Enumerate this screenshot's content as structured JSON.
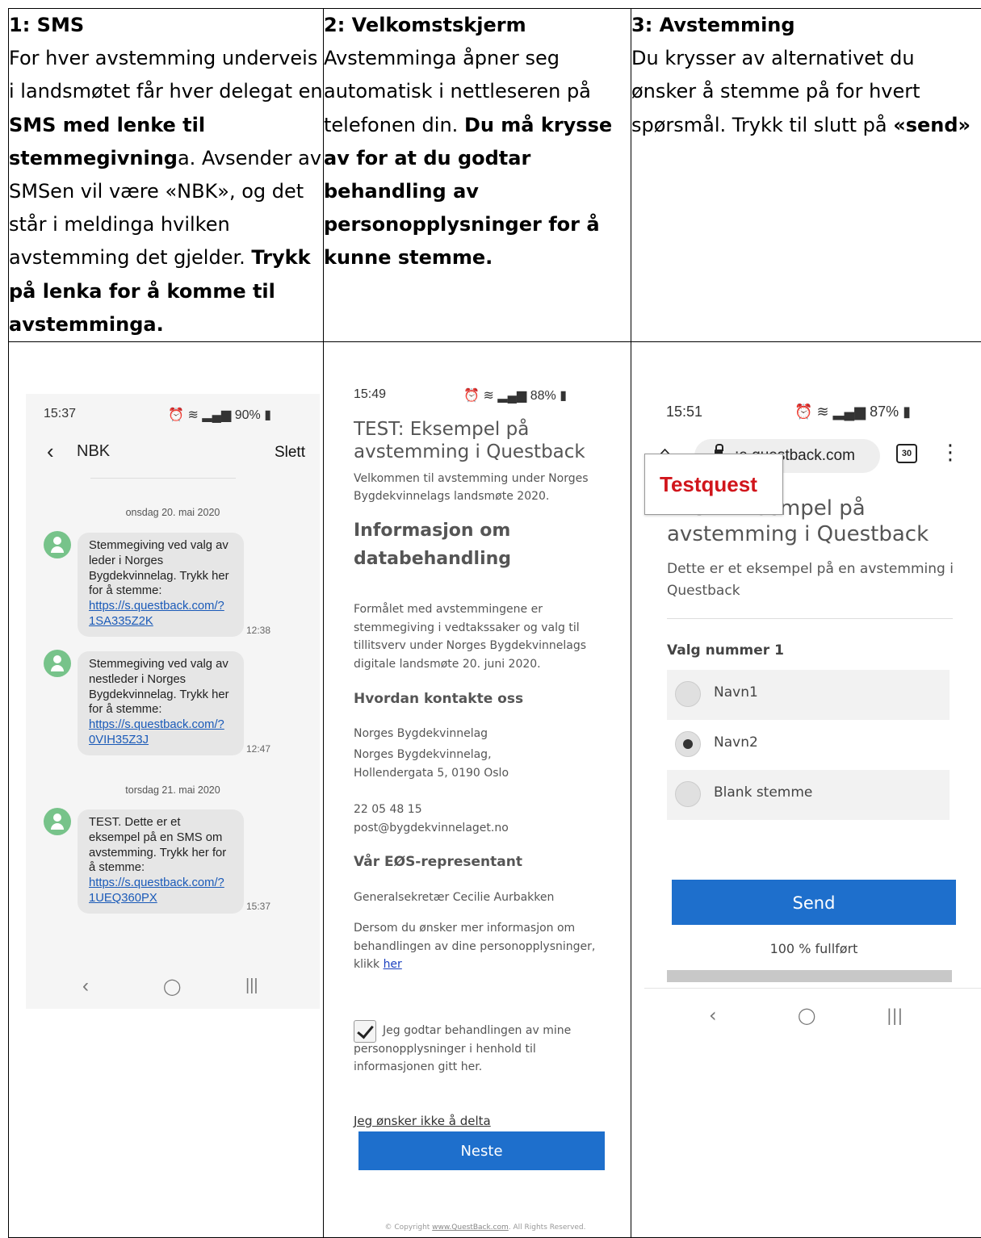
{
  "columns": [
    {
      "heading": "1: SMS",
      "text": [
        {
          "t": "For hver avstemming underveis i landsmøtet får hver delegat en ",
          "b": false
        },
        {
          "t": "SMS med lenke til stemmegivning",
          "b": true
        },
        {
          "t": "a. Avsender av SMSen vil være «NBK», og det står i meldinga hvilken avstemming det gjelder. ",
          "b": false
        },
        {
          "t": "Trykk på lenka for å komme til avstemminga.",
          "b": true
        }
      ]
    },
    {
      "heading": "2: Velkomstskjerm",
      "text": [
        {
          "t": "Avstemminga åpner seg automatisk i nettleseren på telefonen din. ",
          "b": false
        },
        {
          "t": "Du må krysse av for at du godtar behandling av personopplysninger for å kunne stemme.",
          "b": true
        }
      ]
    },
    {
      "heading": "3: Avstemming",
      "text": [
        {
          "t": "Du krysser av alternativet du ønsker å stemme på for hvert spørsmål. Trykk til slutt på ",
          "b": false
        },
        {
          "t": "«send»",
          "b": true
        }
      ]
    }
  ],
  "sms": {
    "time": "15:37",
    "status_right": "90%",
    "contact": "NBK",
    "delete_label": "Slett",
    "date1": "onsdag 20. mai 2020",
    "date2": "torsdag 21. mai 2020",
    "messages": [
      {
        "text": "Stemmegiving ved valg av leder i Norges Bygdekvinnelag. Trykk her for å stemme:",
        "link": "https://s.questback.com/?1SA335Z2K",
        "time": "12:38"
      },
      {
        "text": "Stemmegiving ved valg av nestleder i Norges Bygdekvinnelag. Trykk her for å stemme:",
        "link": "https://s.questback.com/?0VIH35Z3J",
        "time": "12:47"
      },
      {
        "text": "TEST. Dette er et eksempel på en SMS om avstemming. Trykk her for å stemme:",
        "link": "https://s.questback.com/?1UEQ360PX",
        "time": "15:37"
      }
    ]
  },
  "welcome": {
    "time": "15:49",
    "status_right": "88%",
    "title": "TEST: Eksempel på avstemming i Questback",
    "intro": "Velkommen til avstemming under Norges Bygdekvinnelags landsmøte 2020.",
    "heading": "Informasjon om databehandling",
    "purpose": "Formålet med avstemmingene er stemmegiving i vedtakssaker og valg til tillitsverv under Norges Bygdekvinnelags digitale landsmøte 20. juni 2020.",
    "contact_heading": "Hvordan kontakte oss",
    "org": "Norges Bygdekvinnelag",
    "address_line1": "Norges Bygdekvinnelag,",
    "address_line2": "Hollendergata 5, 0190 Oslo",
    "phone": "22 05 48 15",
    "email": "post@bygdekvinnelaget.no",
    "rep_heading": "Vår EØS-representant",
    "rep": "Generalsekretær Cecilie Aurbakken",
    "more_info": "Dersom du ønsker mer informasjon om behandlingen av dine personopplysninger, klikk ",
    "more_link": "her",
    "consent": "Jeg godtar behandlingen av mine personopplysninger i henhold til informasjonen gitt her.",
    "decline": "Jeg ønsker ikke å delta",
    "next": "Neste",
    "copyright_pre": "© Copyright ",
    "copyright_link": "www.QuestBack.com",
    "copyright_post": ". All Rights Reserved."
  },
  "vote": {
    "time": "15:51",
    "status_right": "87%",
    "url": ":e.questback.com",
    "tab_count": "30",
    "logo": "Testquest",
    "title": "TEST: Eksempel på avstemming i Questback",
    "description": "Dette er et eksempel på en avstemming i Questback",
    "question": "Valg nummer 1",
    "options": [
      {
        "label": "Navn1",
        "selected": false
      },
      {
        "label": "Navn2",
        "selected": true
      },
      {
        "label": "Blank stemme",
        "selected": false
      }
    ],
    "send": "Send",
    "progress_label": "100 % fullført",
    "progress": 1.0
  },
  "icons": {
    "back": "chevron-left-icon",
    "home": "home-icon",
    "lock": "lock-icon",
    "menu": "kebab-menu-icon",
    "nav_back": "nav-back-icon",
    "nav_home": "nav-home-icon",
    "nav_recent": "nav-recent-icon"
  },
  "colors": {
    "accent": "#1e6fcc",
    "logo_red": "#d1151b",
    "link": "#1a5ab8"
  }
}
